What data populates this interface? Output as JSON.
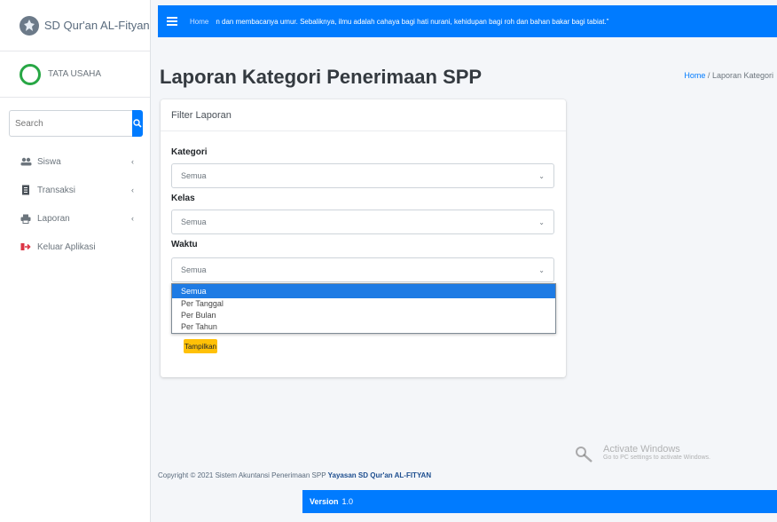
{
  "sidebar": {
    "brand": "SD Qur'an AL-Fityan",
    "user": "TATA USAHA",
    "search_placeholder": "Search",
    "items": [
      {
        "label": "Siswa",
        "icon": "users-icon",
        "has_caret": true
      },
      {
        "label": "Transaksi",
        "icon": "receipt-icon",
        "has_caret": true
      },
      {
        "label": "Laporan",
        "icon": "printer-icon",
        "has_caret": true
      },
      {
        "label": "Keluar Aplikasi",
        "icon": "logout-icon",
        "has_caret": false
      }
    ]
  },
  "navbar": {
    "home": "Home",
    "marquee": "n dan membacanya umur. Sebaliknya, ilmu adalah cahaya bagi hati nurani, kehidupan bagi roh dan bahan bakar bagi tabiat.\""
  },
  "page": {
    "title": "Laporan Kategori Penerimaan SPP",
    "breadcrumb_home": "Home",
    "breadcrumb_sep": "/",
    "breadcrumb_current": "Laporan Kategori"
  },
  "card": {
    "header": "Filter Laporan",
    "kategori_label": "Kategori",
    "kategori_value": "Semua",
    "kelas_label": "Kelas",
    "kelas_value": "Semua",
    "waktu_label": "Waktu",
    "waktu_value": "Semua",
    "waktu_options": [
      "Semua",
      "Per Tanggal",
      "Per Bulan",
      "Per Tahun"
    ],
    "button_label": "Tampilkan"
  },
  "footer": {
    "copyright": "Copyright © 2021 Sistem Akuntansi Penerimaan SPP",
    "org": "Yayasan SD Qur'an AL-FITYAN",
    "version_label": "Version",
    "version_value": "1.0"
  },
  "watermark": {
    "title": "Activate Windows",
    "subtitle": "Go to PC settings to activate Windows."
  },
  "colors": {
    "primary": "#007bff",
    "success": "#28a745",
    "warning": "#ffc107",
    "selected_option": "#1e7be4"
  }
}
